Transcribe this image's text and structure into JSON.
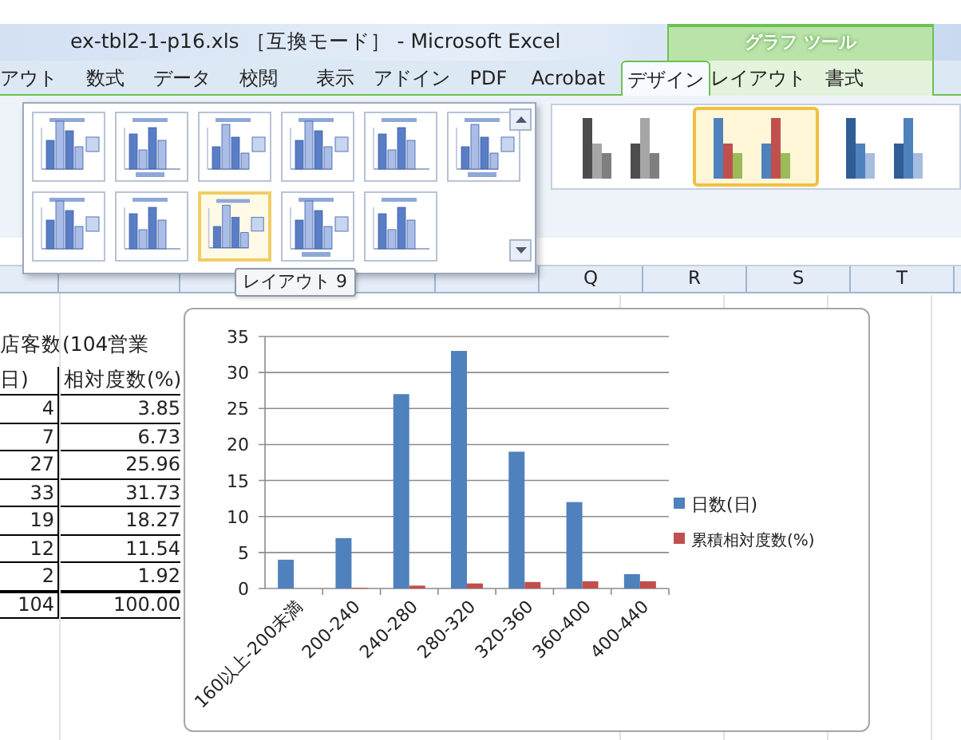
{
  "window": {
    "title": "ex-tbl2-1-p16.xls ［互換モード］ - Microsoft Excel"
  },
  "contextual_tab_group": {
    "label": "グラフ ツール"
  },
  "ribbon_tabs": [
    {
      "label": "アウト",
      "selected": false
    },
    {
      "label": "数式",
      "selected": false
    },
    {
      "label": "データ",
      "selected": false
    },
    {
      "label": "校閲",
      "selected": false
    },
    {
      "label": "表示",
      "selected": false
    },
    {
      "label": "アドイン",
      "selected": false
    },
    {
      "label": "PDF",
      "selected": false
    },
    {
      "label": "Acrobat",
      "selected": false
    },
    {
      "label": "デザイン",
      "selected": true
    },
    {
      "label": "レイアウト",
      "selected": false
    },
    {
      "label": "書式",
      "selected": false
    }
  ],
  "layout_gallery": {
    "items": [
      {
        "selected": false
      },
      {
        "selected": false
      },
      {
        "selected": false
      },
      {
        "selected": false
      },
      {
        "selected": false
      },
      {
        "selected": false
      },
      {
        "selected": false
      },
      {
        "selected": false
      },
      {
        "selected": true
      },
      {
        "selected": false
      },
      {
        "selected": false
      }
    ],
    "tooltip": "レイアウト 9"
  },
  "chart_styles": [
    {
      "kind": "gray",
      "selected": false
    },
    {
      "kind": "color",
      "selected": true
    },
    {
      "kind": "blue",
      "selected": false
    }
  ],
  "column_headers": [
    "Q",
    "R",
    "S",
    "T"
  ],
  "sheet": {
    "title": "店客数(104営業",
    "columns": [
      "日)",
      "相対度数(%)"
    ],
    "rows": [
      [
        "4",
        "3.85"
      ],
      [
        "7",
        "6.73"
      ],
      [
        "27",
        "25.96"
      ],
      [
        "33",
        "31.73"
      ],
      [
        "19",
        "18.27"
      ],
      [
        "12",
        "11.54"
      ],
      [
        "2",
        "1.92"
      ],
      [
        "104",
        "100.00"
      ]
    ]
  },
  "chart": {
    "chart_data": {
      "type": "bar",
      "categories": [
        "160以上-200未満",
        "200-240",
        "240-280",
        "280-320",
        "320-360",
        "360-400",
        "400-440"
      ],
      "series": [
        {
          "name": "日数(日)",
          "color": "#4f81bd",
          "values": [
            4,
            7,
            27,
            33,
            19,
            12,
            2
          ]
        },
        {
          "name": "累積相対度数(%)",
          "color": "#c0504d",
          "values": [
            0.0,
            0.1,
            0.4,
            0.7,
            0.9,
            1.0,
            1.0
          ]
        }
      ],
      "grid": true,
      "legend": true,
      "ylim": [
        0,
        35
      ],
      "yticks": [
        0,
        5,
        10,
        15,
        20,
        25,
        30,
        35
      ]
    }
  }
}
